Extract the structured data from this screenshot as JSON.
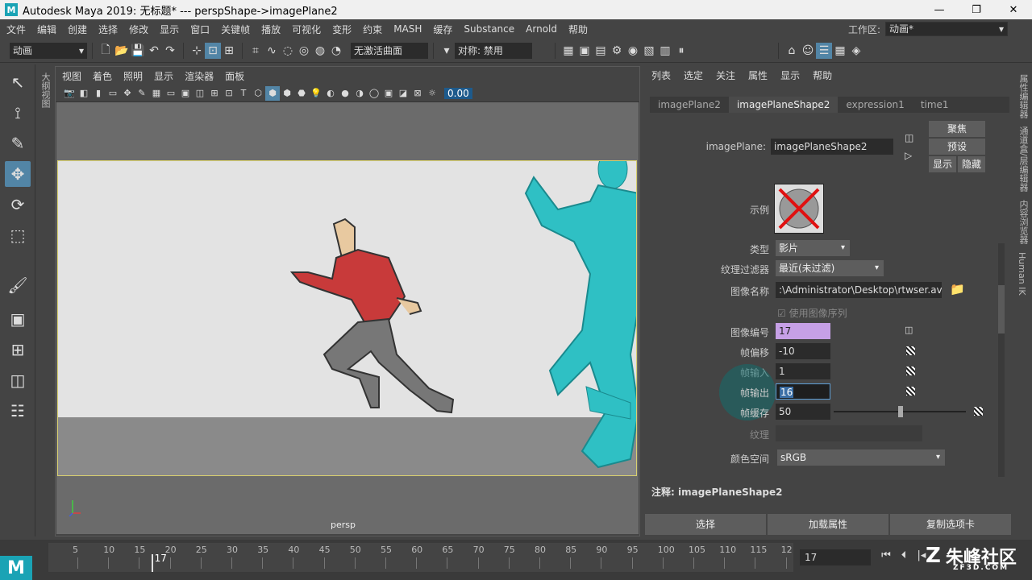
{
  "titlebar": {
    "title": "Autodesk Maya 2019: 无标题*   ---   perspShape->imagePlane2"
  },
  "menubar": {
    "items": [
      "文件",
      "编辑",
      "创建",
      "选择",
      "修改",
      "显示",
      "窗口",
      "关键帧",
      "播放",
      "可视化",
      "变形",
      "约束",
      "MASH",
      "缓存",
      "Substance",
      "Arnold",
      "帮助"
    ],
    "workspace_label": "工作区:",
    "workspace_value": "动画*"
  },
  "toolbar": {
    "mode": "动画",
    "surface": "无激活曲面",
    "symmetry": "对称: 禁用"
  },
  "outliner_label": "大纲视图",
  "viewport": {
    "menu": [
      "视图",
      "着色",
      "照明",
      "显示",
      "渲染器",
      "面板"
    ],
    "value_field": "0.00",
    "camera_label": "persp"
  },
  "attr_editor": {
    "menu": [
      "列表",
      "选定",
      "关注",
      "属性",
      "显示",
      "帮助"
    ],
    "tabs": [
      "imagePlane2",
      "imagePlaneShape2",
      "expression1",
      "time1"
    ],
    "active_tab": "imagePlaneShape2",
    "node_label": "imagePlane:",
    "node_value": "imagePlaneShape2",
    "buttons": {
      "focus": "聚焦",
      "preset": "预设",
      "show": "显示",
      "hide": "隐藏"
    },
    "sample_label": "示例",
    "type_label": "类型",
    "type_value": "影片",
    "filter_label": "纹理过滤器",
    "filter_value": "最近(未过滤)",
    "image_name_label": "图像名称",
    "image_name_value": ":\\Administrator\\Desktop\\rtwser.avi",
    "use_sequence": "使用图像序列",
    "image_number_label": "图像编号",
    "image_number_value": "17",
    "frame_offset_label": "帧偏移",
    "frame_offset_value": "-10",
    "frame_in_label": "帧输入",
    "frame_in_value": "1",
    "frame_out_label": "帧输出",
    "frame_out_value": "16",
    "frame_cache_label": "帧缓存",
    "frame_cache_value": "50",
    "texture_label": "纹理",
    "colorspace_label": "颜色空间",
    "colorspace_value": "sRGB",
    "note_label": "注释:",
    "note_value": "imagePlaneShape2",
    "bottom_buttons": [
      "选择",
      "加载属性",
      "复制选项卡"
    ]
  },
  "right_strip": [
    "属性编辑器",
    "通道盒/层编辑器",
    "内容浏览器",
    "Human IK"
  ],
  "timeline": {
    "ticks": [
      "5",
      "10",
      "15",
      "20",
      "25",
      "30",
      "35",
      "40",
      "45",
      "50",
      "55",
      "60",
      "65",
      "70",
      "75",
      "80",
      "85",
      "90",
      "95",
      "100",
      "105",
      "110",
      "115",
      "12"
    ],
    "current_frame": "17",
    "frame_field": "17"
  },
  "watermark": {
    "main": "朱峰社区",
    "sub": "ZF3D.COM"
  },
  "colors": {
    "accent": "#5285a6",
    "character": "#2fc0c4",
    "highlight_field": "#c6a0e6"
  }
}
